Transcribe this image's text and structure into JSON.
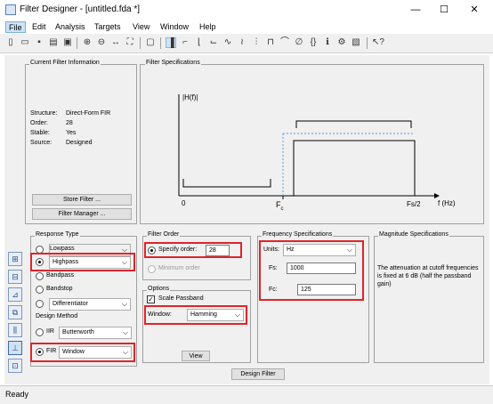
{
  "window": {
    "title": "Filter Designer - [untitled.fda *]",
    "min": "—",
    "max": "☐",
    "close": "✕"
  },
  "menu": [
    "File",
    "Edit",
    "Analysis",
    "Targets",
    "View",
    "Window",
    "Help"
  ],
  "toolbar_icons": [
    "new-icon",
    "open-icon",
    "save-icon",
    "print-icon",
    "print-preview-icon",
    "zoom-in-icon",
    "zoom-out-icon",
    "zoom-x-icon",
    "full-view-icon",
    "new-figure-icon",
    "filter-specifications-icon",
    "magnitude-response-icon",
    "phase-response-icon",
    "magnitude-phase-icon",
    "group-delay-icon",
    "phase-delay-icon",
    "impulse-response-icon",
    "step-response-icon",
    "pole-zero-icon",
    "coefficients-icon",
    "information-icon",
    "cost-icon",
    "legend-icon",
    "whats-this-icon"
  ],
  "current_filter": {
    "legend": "Current Filter Information",
    "rows": [
      {
        "k": "Structure:",
        "v": "Direct-Form FIR"
      },
      {
        "k": "Order:",
        "v": "28"
      },
      {
        "k": "Stable:",
        "v": "Yes"
      },
      {
        "k": "Source:",
        "v": "Designed"
      }
    ],
    "store_btn": "Store Filter ...",
    "manager_btn": "Filter Manager ..."
  },
  "filter_spec": {
    "legend": "Filter Specifications",
    "ylabel": "|H(f)|",
    "x0": "0",
    "fc": "F",
    "fc_sub": "c",
    "fs2": "Fs/2",
    "xunit": "f (Hz)"
  },
  "response_type": {
    "legend": "Response Type",
    "lowpass": "Lowpass",
    "highpass": "Highpass",
    "bandpass": "Bandpass",
    "bandstop": "Bandstop",
    "differentiator": "Differentiator",
    "arrow": "⌵"
  },
  "design_method": {
    "legend": "Design Method",
    "iir_label": "IIR",
    "iir_value": "Butterworth",
    "fir_label": "FIR",
    "fir_value": "Window"
  },
  "filter_order": {
    "legend": "Filter Order",
    "specify_label": "Specify order:",
    "order_value": "28",
    "minimum_label": "Minimum order"
  },
  "options": {
    "legend": "Options",
    "scale_label": "Scale Passband",
    "check": "✓",
    "window_label": "Window:",
    "window_value": "Hamming",
    "view_btn": "View"
  },
  "freq_spec": {
    "legend": "Frequency Specifications",
    "units_label": "Units:",
    "units_value": "Hz",
    "fs_label": "Fs:",
    "fs_value": "1000",
    "fc_label": "Fc:",
    "fc_value": "125"
  },
  "mag_spec": {
    "legend": "Magnitude Specifications",
    "note": "The attenuation at cutoff frequencies is fixed at 6 dB (half the passband gain)"
  },
  "design_btn": "Design Filter",
  "status": "Ready"
}
